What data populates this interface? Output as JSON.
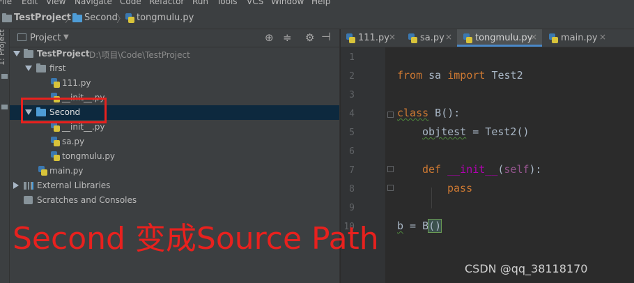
{
  "menu": [
    "File",
    "Edit",
    "View",
    "Navigate",
    "Code",
    "Refactor",
    "Run",
    "Tools",
    "VCS",
    "Window",
    "Help"
  ],
  "breadcrumb": [
    "TestProject",
    "Second",
    "tongmulu.py"
  ],
  "tool_strip": {
    "label": "1: Project"
  },
  "project_panel": {
    "title": "Project",
    "tree": [
      {
        "label": "TestProject",
        "path": "D:\\项目\\Code\\TestProject"
      },
      {
        "label": "first"
      },
      {
        "label": "111.py"
      },
      {
        "label": "__init__.py"
      },
      {
        "label": "Second"
      },
      {
        "label": "__init__.py"
      },
      {
        "label": "sa.py"
      },
      {
        "label": "tongmulu.py"
      },
      {
        "label": "main.py"
      },
      {
        "label": "External Libraries"
      },
      {
        "label": "Scratches and Consoles"
      }
    ]
  },
  "tabs": [
    {
      "label": "111.py",
      "active": false
    },
    {
      "label": "sa.py",
      "active": false
    },
    {
      "label": "tongmulu.py",
      "active": true
    },
    {
      "label": "main.py",
      "active": false
    }
  ],
  "close_glyph": "×",
  "editor": {
    "line_numbers": [
      "1",
      "2",
      "3",
      "4",
      "5",
      "6",
      "7",
      "8",
      "9",
      "10"
    ],
    "tokens": {
      "from": "from",
      "module": " sa ",
      "import": "import",
      "imported": " Test2",
      "class_kw": "class",
      "class_rest": " B():",
      "objtest": "objtest",
      "assign_rest": " = Test2()",
      "def_kw": "def",
      "init_name": "__init__",
      "open_paren": "(",
      "self": "self",
      "close_def": "):",
      "pass": "pass",
      "b_var": "b",
      "b_assign": " = B",
      "b_parens": "()"
    }
  },
  "annotation": "Second 变成Source Path",
  "watermark": "CSDN @qq_38118170",
  "colors": {
    "selection": "#0d293e",
    "annotation_red": "#e8211e",
    "keyword": "#cc7832",
    "accent_tab": "#4a88c7"
  }
}
